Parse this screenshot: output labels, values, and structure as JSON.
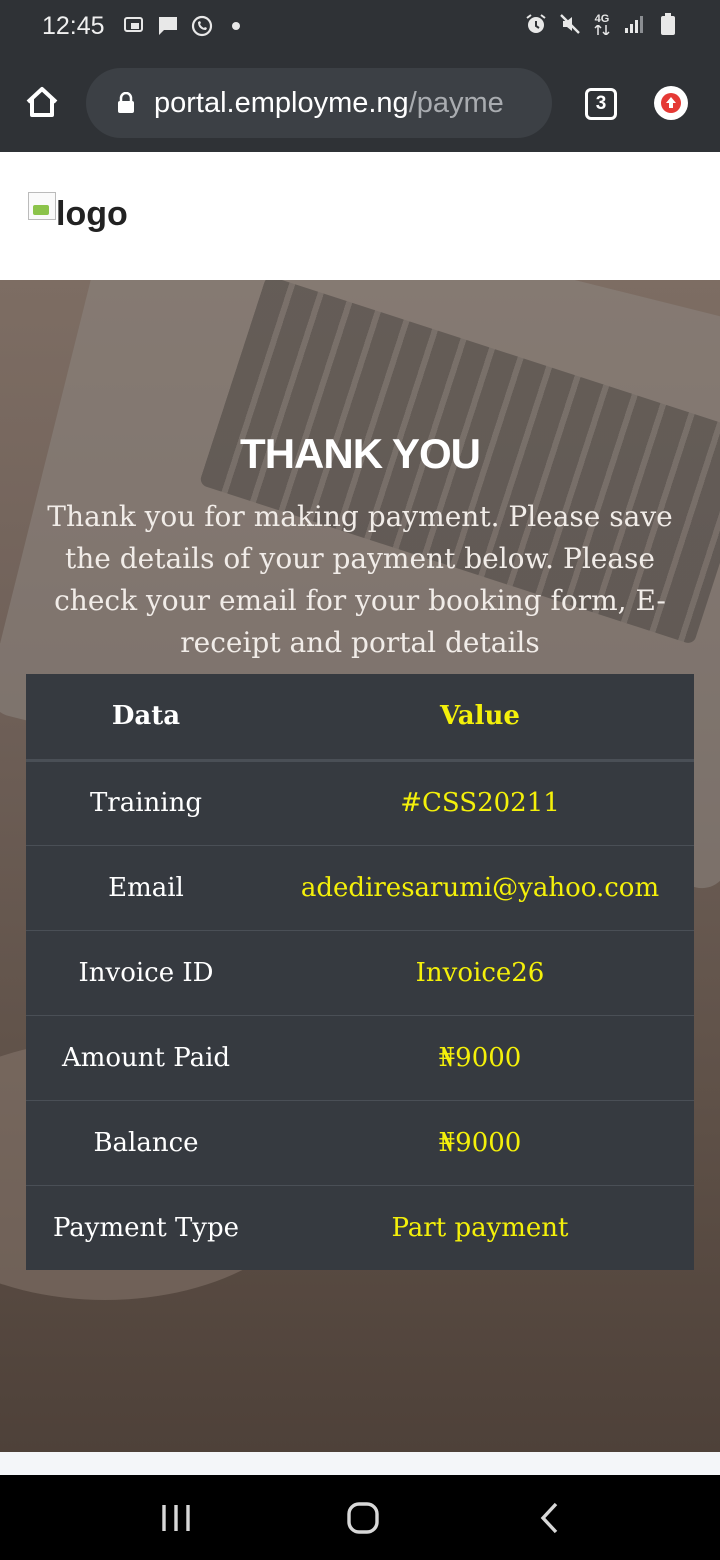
{
  "status_bar": {
    "time": "12:45",
    "network": "4G",
    "icons_left": [
      "cast-icon",
      "message-icon",
      "whatsapp-icon",
      "dot-icon"
    ],
    "icons_right": [
      "alarm-icon",
      "mute-icon",
      "network-4g-icon",
      "signal-icon",
      "battery-icon"
    ]
  },
  "browser": {
    "url_host": "portal.employme.ng",
    "url_path": "/payme",
    "tab_count": "3"
  },
  "header": {
    "logo_alt": "logo"
  },
  "hero": {
    "title": "THANK YOU",
    "message": "Thank you for making payment. Please save the details of your payment below. Please check your email for your booking form, E-receipt and portal details"
  },
  "table": {
    "headers": {
      "data": "Data",
      "value": "Value"
    },
    "rows": [
      {
        "label": "Training",
        "value": "#CSS20211"
      },
      {
        "label": "Email",
        "value": "adediresarumi@yahoo.com"
      },
      {
        "label": "Invoice ID",
        "value": "Invoice26"
      },
      {
        "label": "Amount Paid",
        "value": "₦9000"
      },
      {
        "label": "Balance",
        "value": "₦9000"
      },
      {
        "label": "Payment Type",
        "value": "Part payment"
      }
    ]
  },
  "colors": {
    "value_text": "#f4f00a",
    "table_bg": "#363a40",
    "chrome_bg": "#2f3236"
  }
}
